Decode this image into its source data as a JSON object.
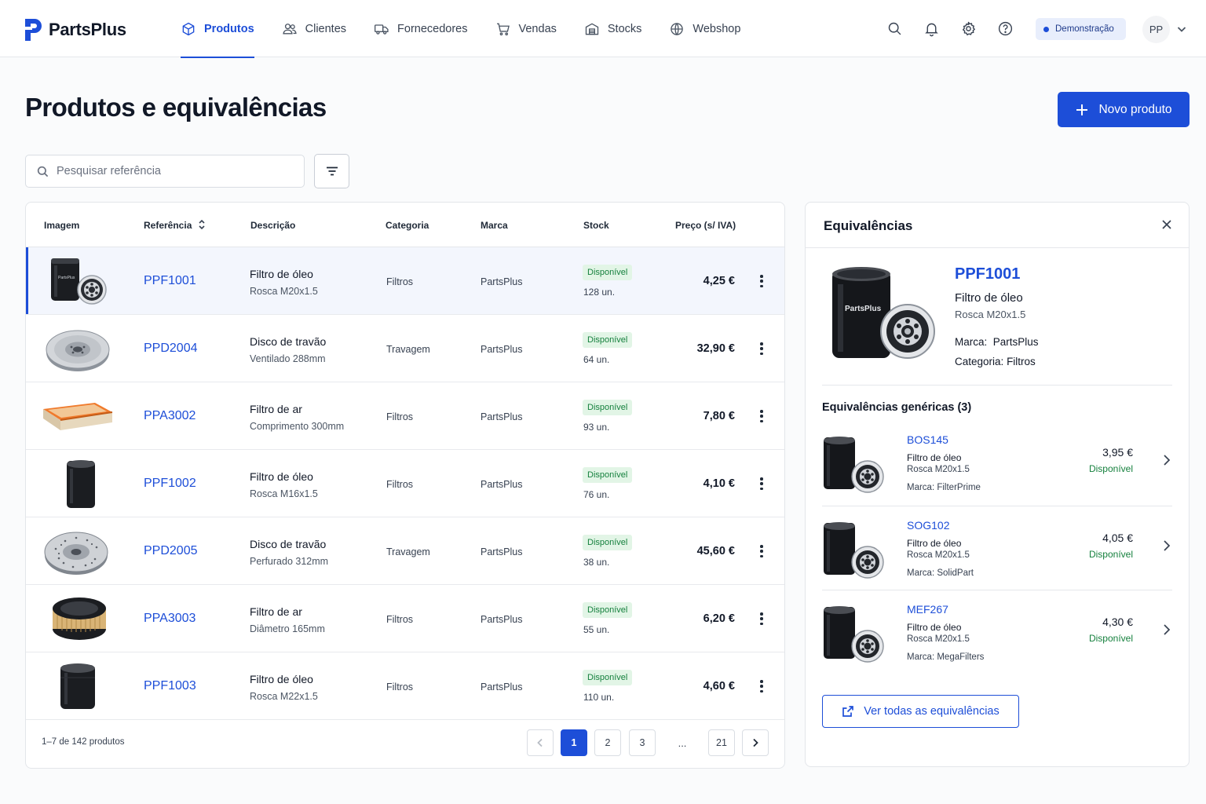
{
  "app": {
    "name": "PartsPlus"
  },
  "nav": [
    {
      "label": "Produtos",
      "icon": "box-icon",
      "active": true
    },
    {
      "label": "Clientes",
      "icon": "users-icon",
      "active": false
    },
    {
      "label": "Fornecedores",
      "icon": "truck-icon",
      "active": false
    },
    {
      "label": "Vendas",
      "icon": "cart-icon",
      "active": false
    },
    {
      "label": "Stocks",
      "icon": "warehouse-icon",
      "active": false
    },
    {
      "label": "Webshop",
      "icon": "globe-icon",
      "active": false
    }
  ],
  "header": {
    "env_badge": "Demonstração",
    "user_initials": "PP"
  },
  "page": {
    "title": "Produtos e equivalências",
    "new_button": "Novo produto"
  },
  "search": {
    "placeholder": "Pesquisar referência"
  },
  "table": {
    "columns": [
      "Imagem",
      "Referência",
      "Descrição",
      "Categoria",
      "Marca",
      "Stock",
      "Preço (s/ IVA)"
    ],
    "rows": [
      {
        "ref": "PPF1001",
        "desc": "Filtro de óleo",
        "sub": "Rosca M20x1.5",
        "category": "Filtros",
        "brand": "PartsPlus",
        "status": "Disponível",
        "stock": "128 un.",
        "price": "4,25 €",
        "image": "oil-filter-with-base",
        "selected": true
      },
      {
        "ref": "PPD2004",
        "desc": "Disco de travão",
        "sub": "Ventilado 288mm",
        "category": "Travagem",
        "brand": "PartsPlus",
        "status": "Disponível",
        "stock": "64 un.",
        "price": "32,90 €",
        "image": "brake-disc"
      },
      {
        "ref": "PPA3002",
        "desc": "Filtro de ar",
        "sub": "Comprimento 300mm",
        "category": "Filtros",
        "brand": "PartsPlus",
        "status": "Disponível",
        "stock": "93 un.",
        "price": "7,80 €",
        "image": "panel-air-filter"
      },
      {
        "ref": "PPF1002",
        "desc": "Filtro de óleo",
        "sub": "Rosca M16x1.5",
        "category": "Filtros",
        "brand": "PartsPlus",
        "status": "Disponível",
        "stock": "76 un.",
        "price": "4,10 €",
        "image": "oil-filter"
      },
      {
        "ref": "PPD2005",
        "desc": "Disco de travão",
        "sub": "Perfurado 312mm",
        "category": "Travagem",
        "brand": "PartsPlus",
        "status": "Disponível",
        "stock": "38 un.",
        "price": "45,60 €",
        "image": "drilled-brake-disc"
      },
      {
        "ref": "PPA3003",
        "desc": "Filtro de ar",
        "sub": "Diâmetro 165mm",
        "category": "Filtros",
        "brand": "PartsPlus",
        "status": "Disponível",
        "stock": "55 un.",
        "price": "6,20 €",
        "image": "round-air-filter"
      },
      {
        "ref": "PPF1003",
        "desc": "Filtro de óleo",
        "sub": "Rosca M22x1.5",
        "category": "Filtros",
        "brand": "PartsPlus",
        "status": "Disponível",
        "stock": "110 un.",
        "price": "4,60 €",
        "image": "oil-filter"
      }
    ],
    "footer": "1–7 de 142 produtos",
    "pages": [
      "1",
      "2",
      "3",
      "...",
      "21"
    ],
    "current_page": "1"
  },
  "equivalences": {
    "title": "Equivalências",
    "product": {
      "ref": "PPF1001",
      "desc": "Filtro de óleo",
      "sub": "Rosca M20x1.5",
      "brand_label": "Marca:",
      "brand": "PartsPlus",
      "category_label": "Categoria:",
      "category": "Filtros",
      "image_text": "PartsPlus"
    },
    "section_title": "Equivalências genéricas (3)",
    "items": [
      {
        "ref": "BOS145",
        "desc": "Filtro de óleo",
        "sub": "Rosca M20x1.5",
        "brand": "Marca: FilterPrime",
        "price": "3,95 €",
        "status": "Disponível"
      },
      {
        "ref": "SOG102",
        "desc": "Filtro de óleo",
        "sub": "Rosca M20x1.5",
        "brand": "Marca: SolidPart",
        "price": "4,05 €",
        "status": "Disponível"
      },
      {
        "ref": "MEF267",
        "desc": "Filtro de óleo",
        "sub": "Rosca M20x1.5",
        "brand": "Marca: MegaFilters",
        "price": "4,30 €",
        "status": "Disponível"
      }
    ],
    "view_all": "Ver todas as equivalências"
  },
  "colors": {
    "primary": "#1d4ed8",
    "success": "#15803d",
    "success_bg": "#e2f5e6",
    "selected_row": "#f3f6fd"
  }
}
